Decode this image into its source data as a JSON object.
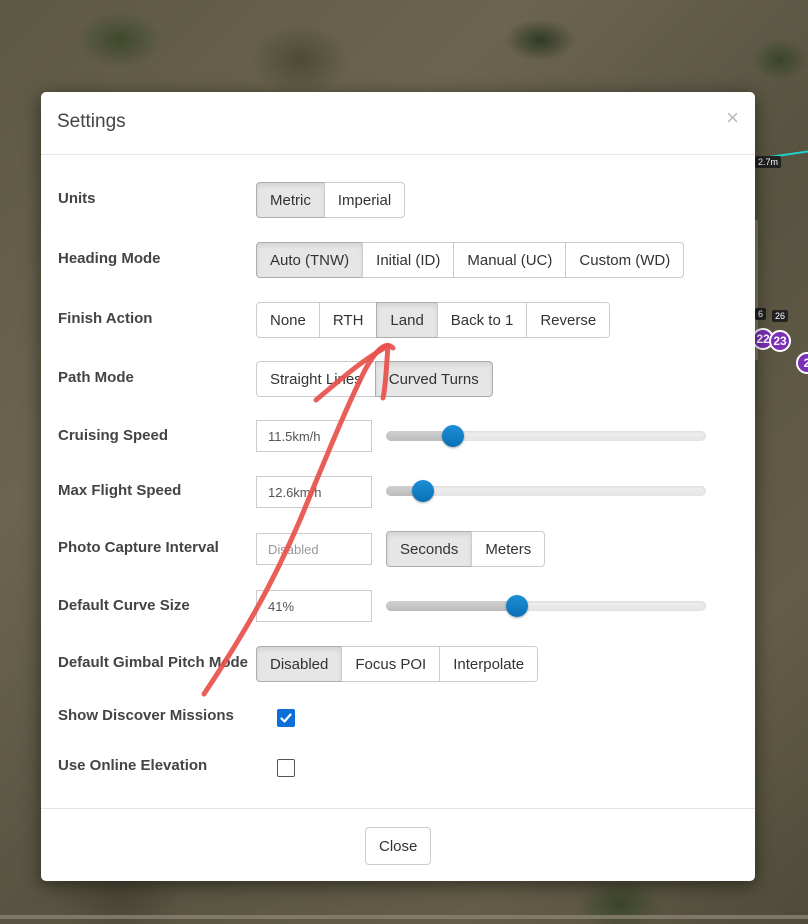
{
  "modal": {
    "title": "Settings",
    "close_x": "×",
    "close_button": "Close"
  },
  "settings": {
    "units": {
      "label": "Units",
      "options": [
        "Metric",
        "Imperial"
      ],
      "selected": "Metric"
    },
    "heading_mode": {
      "label": "Heading Mode",
      "options": [
        "Auto (TNW)",
        "Initial (ID)",
        "Manual (UC)",
        "Custom (WD)"
      ],
      "selected": "Auto (TNW)"
    },
    "finish_action": {
      "label": "Finish Action",
      "options": [
        "None",
        "RTH",
        "Land",
        "Back to 1",
        "Reverse"
      ],
      "selected": "Land"
    },
    "path_mode": {
      "label": "Path Mode",
      "options": [
        "Straight Lines",
        "Curved Turns"
      ],
      "selected": "Curved Turns"
    },
    "cruising_speed": {
      "label": "Cruising Speed",
      "value": "11.5km/h",
      "slider_fraction": 0.21
    },
    "max_flight_speed": {
      "label": "Max Flight Speed",
      "value": "12.6km/h",
      "slider_fraction": 0.115
    },
    "photo_capture_interval": {
      "label": "Photo Capture Interval",
      "value": "Disabled",
      "options": [
        "Seconds",
        "Meters"
      ],
      "selected": "Seconds"
    },
    "default_curve_size": {
      "label": "Default Curve Size",
      "value": "41%",
      "slider_fraction": 0.41
    },
    "default_gimbal_pitch_mode": {
      "label": "Default Gimbal Pitch Mode",
      "options": [
        "Disabled",
        "Focus POI",
        "Interpolate"
      ],
      "selected": "Disabled"
    },
    "show_discover_missions": {
      "label": "Show Discover Missions",
      "checked": true
    },
    "use_online_elevation": {
      "label": "Use Online Elevation",
      "checked": false
    }
  },
  "map": {
    "waypoints": [
      "22",
      "23",
      "2"
    ],
    "chips": [
      "6",
      "26",
      "2.7m"
    ]
  },
  "colors": {
    "accent": "#0a6fd8",
    "slider_handle": "#0f7cc4",
    "annotation_arrow": "#e8504c",
    "waypoint": "#7a2fb5"
  }
}
